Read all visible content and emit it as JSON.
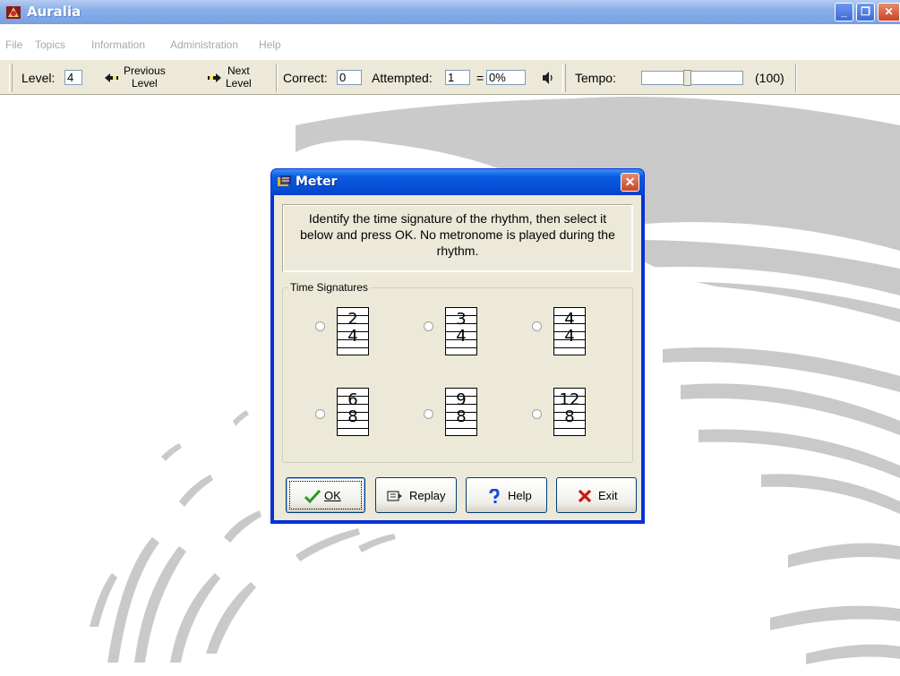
{
  "window": {
    "title": "Auralia",
    "minimize_icon": "minimize-icon",
    "restore_icon": "restore-icon",
    "close_icon": "close-icon"
  },
  "menu": [
    "File",
    "Topics",
    "Information",
    "Administration",
    "Help"
  ],
  "toolbar": {
    "level_label": "Level:",
    "level_value": "4",
    "previous": {
      "line1": "Previous",
      "line2": "Level"
    },
    "next": {
      "line1": "Next",
      "line2": "Level"
    },
    "correct_label": "Correct:",
    "correct_value": "0",
    "attempted_label": "Attempted:",
    "attempted_value": "1",
    "equals": "=",
    "percent_value": "0%",
    "tempo_label": "Tempo:",
    "tempo_value": "(100)",
    "tempo_fill": 0.45
  },
  "dialog": {
    "title": "Meter",
    "instructions": "Identify the time signature of the rhythm, then select it below and press OK. No metronome is played during the rhythm.",
    "group_label": "Time Signatures",
    "time_signatures": [
      {
        "top": "2",
        "bottom": "4"
      },
      {
        "top": "3",
        "bottom": "4"
      },
      {
        "top": "4",
        "bottom": "4"
      },
      {
        "top": "6",
        "bottom": "8"
      },
      {
        "top": "9",
        "bottom": "8"
      },
      {
        "top": "12",
        "bottom": "8"
      }
    ],
    "buttons": {
      "ok": "OK",
      "replay": "Replay",
      "help": "Help",
      "exit": "Exit"
    }
  },
  "colors": {
    "titlebar": "#7aa0e2",
    "dialog_title": "#0550d6",
    "face": "#ece9d8",
    "ok_check": "#2a9a22",
    "exit_x": "#c81818",
    "help_q": "#1a4ad8"
  }
}
